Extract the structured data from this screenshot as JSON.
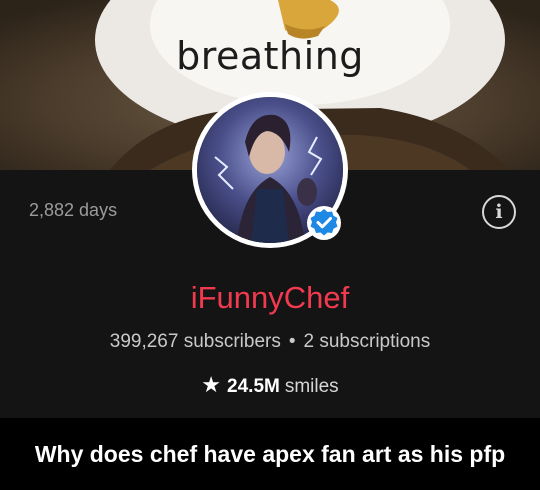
{
  "banner": {
    "caption": "breathing"
  },
  "profile": {
    "days": "2,882 days",
    "info_icon": "info-icon",
    "username": "iFunnyChef",
    "subscribers": "399,267 subscribers",
    "separator": "•",
    "subscriptions": "2 subscriptions",
    "smiles_icon": "star-icon",
    "smiles_count": "24.5M",
    "smiles_label": "smiles",
    "verified_icon": "verified-badge-icon"
  },
  "colors": {
    "username": "#f23a4f",
    "verified": "#1e88e5",
    "profile_bg": "#141414"
  },
  "caption": {
    "text": "Why does chef have apex fan art as his pfp"
  }
}
